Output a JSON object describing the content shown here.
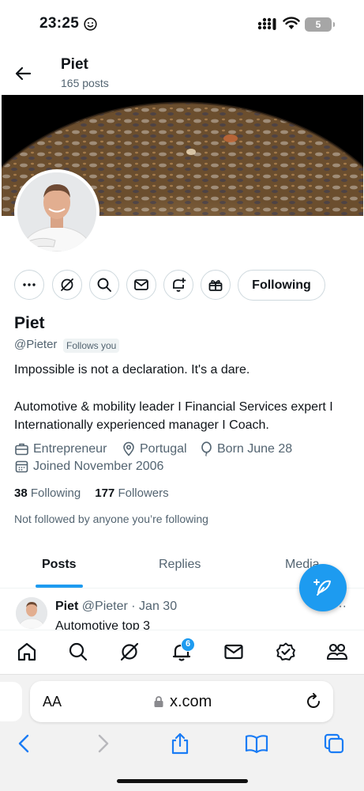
{
  "status_bar": {
    "time": "23:25",
    "battery": "5"
  },
  "header": {
    "name": "Piet",
    "posts": "165 posts"
  },
  "profile": {
    "name": "Piet",
    "handle": "@Pieter",
    "follows_you": "Follows you",
    "bio_line1": "Impossible is not a declaration. It's a dare.",
    "bio_line2": "Automotive & mobility leader I Financial Services expert I Internationally experienced manager I Coach.",
    "category": "Entrepreneur",
    "location": "Portugal",
    "born": "Born June 28",
    "joined": "Joined November 2006",
    "following_count": "38",
    "following_label": "Following",
    "followers_count": "177",
    "followers_label": "Followers",
    "not_followed": "Not followed by anyone you’re following",
    "following_button": "Following"
  },
  "tabs": [
    {
      "label": "Posts",
      "active": true
    },
    {
      "label": "Replies",
      "active": false
    },
    {
      "label": "Media",
      "active": false
    }
  ],
  "post": {
    "name": "Piet",
    "meta": "@Pieter · Jan 30",
    "text": "Automotive top 3",
    "more": "···"
  },
  "bottom_nav": {
    "notification_count": "6",
    "icons": [
      "home-icon",
      "search-icon",
      "grok-icon",
      "bell-icon",
      "mail-icon",
      "verified-icon",
      "communities-icon"
    ]
  },
  "safari": {
    "aa": "AA",
    "url": "x.com"
  },
  "colors": {
    "accent": "#1d9bf0",
    "text": "#0f1419",
    "secondary": "#536471",
    "border": "#cfd9de"
  }
}
